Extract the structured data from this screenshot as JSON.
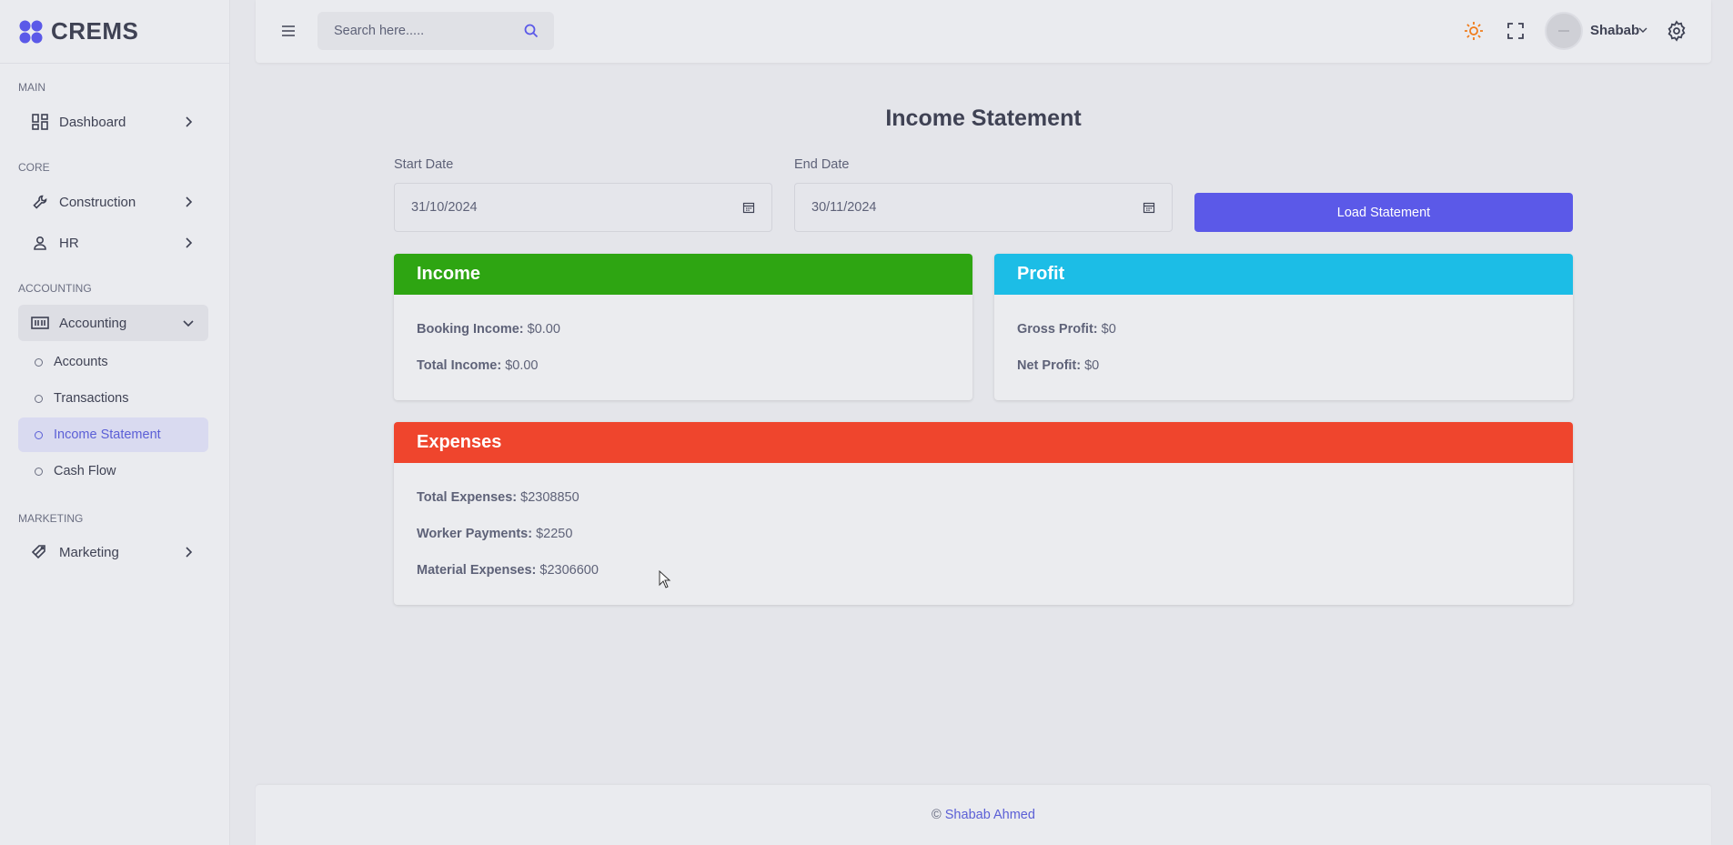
{
  "brand": {
    "name": "CREMS"
  },
  "sidebar": {
    "sections": {
      "main": "MAIN",
      "core": "CORE",
      "accounting": "ACCOUNTING",
      "marketing": "MARKETING"
    },
    "items": {
      "dashboard": "Dashboard",
      "construction": "Construction",
      "hr": "HR",
      "accounting": "Accounting",
      "marketing": "Marketing"
    },
    "accounting_sub": {
      "accounts": "Accounts",
      "transactions": "Transactions",
      "income_statement": "Income Statement",
      "cash_flow": "Cash Flow"
    },
    "active_item": "Income Statement"
  },
  "header": {
    "search": {
      "placeholder": "Search here.....",
      "value": ""
    },
    "user": {
      "name": "Shabab"
    }
  },
  "main": {
    "title": "Income Statement",
    "start_date": {
      "label": "Start Date",
      "value": "31/10/2024"
    },
    "end_date": {
      "label": "End Date",
      "value": "30/11/2024"
    },
    "load_button": "Load Statement",
    "income": {
      "title": "Income",
      "color": "#2ea512",
      "booking_label": "Booking Income:",
      "booking_value": "$0.00",
      "total_label": "Total Income:",
      "total_value": "$0.00"
    },
    "profit": {
      "title": "Profit",
      "color": "#1cbde6",
      "gross_label": "Gross Profit:",
      "gross_value": "$0",
      "net_label": "Net Profit:",
      "net_value": "$0"
    },
    "expenses": {
      "title": "Expenses",
      "color": "#ef452d",
      "total_label": "Total Expenses:",
      "total_value": "$2308850",
      "worker_label": "Worker Payments:",
      "worker_value": "$2250",
      "material_label": "Material Expenses:",
      "material_value": "$2306600"
    }
  },
  "footer": {
    "copyright": "©",
    "author": "Shabab Ahmed"
  },
  "colors": {
    "accent": "#5b59e8",
    "sun_icon": "#f07c1b"
  }
}
